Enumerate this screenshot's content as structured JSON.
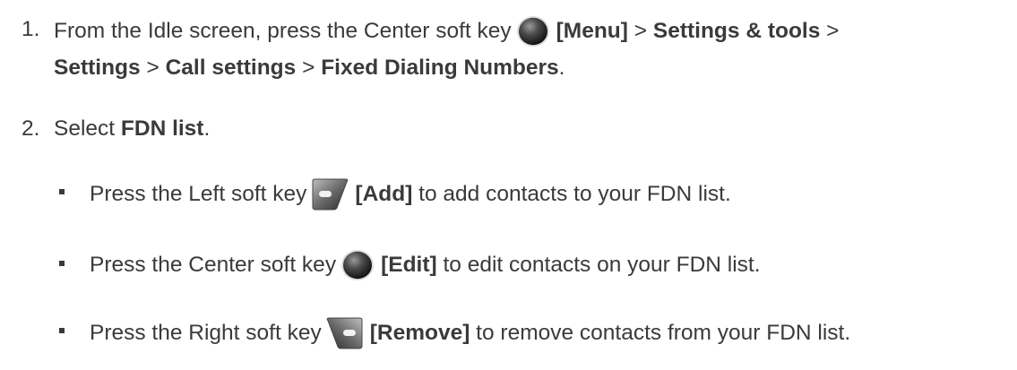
{
  "steps": [
    {
      "number": "1.",
      "line1": {
        "prefix": "From the Idle screen, press the Center soft key",
        "key_label": "[Menu]",
        "sep1": " > ",
        "item1": "Settings & tools",
        "sep2": " >"
      },
      "line2": {
        "item2": "Settings",
        "sep3": " > ",
        "item3": "Call settings",
        "sep4": " > ",
        "item4": "Fixed Dialing Numbers",
        "end": "."
      },
      "key_icon": "center-soft-key-icon"
    },
    {
      "number": "2.",
      "prefix": "Select ",
      "bold": "FDN list",
      "end": "."
    }
  ],
  "bullets": [
    {
      "prefix": "Press the Left soft key",
      "key_icon": "left-soft-key-icon",
      "key_label": "[Add]",
      "suffix": " to add contacts to your FDN list."
    },
    {
      "prefix": "Press the Center soft key",
      "key_icon": "center-soft-key-icon",
      "key_label": "[Edit]",
      "suffix": " to edit contacts on your FDN list."
    },
    {
      "prefix": "Press the Right soft key",
      "key_icon": "right-soft-key-icon",
      "key_label": "[Remove]",
      "suffix": " to remove contacts from your FDN list."
    }
  ]
}
